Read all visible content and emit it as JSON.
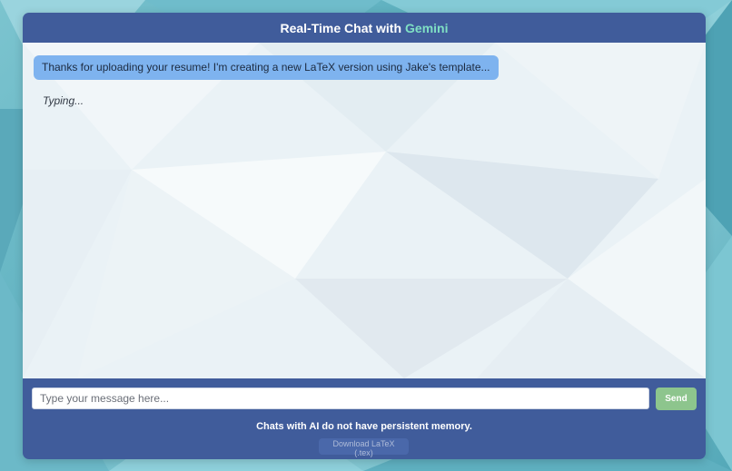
{
  "header": {
    "title_prefix": "Real-Time Chat with",
    "title_brand": "Gemini",
    "brand_color": "#7fe0c4",
    "bar_color": "#405c9b"
  },
  "messages": [
    {
      "role": "assistant",
      "text": "Thanks for uploading your resume! I'm creating a new LaTeX version using Jake's template..."
    }
  ],
  "typing_indicator": "Typing...",
  "composer": {
    "placeholder": "Type your message here...",
    "value": "",
    "send_label": "Send",
    "send_color": "#8dc58d"
  },
  "footer": {
    "notice": "Chats with AI do not have persistent memory.",
    "download_label": "Download LaTeX (.tex)"
  }
}
